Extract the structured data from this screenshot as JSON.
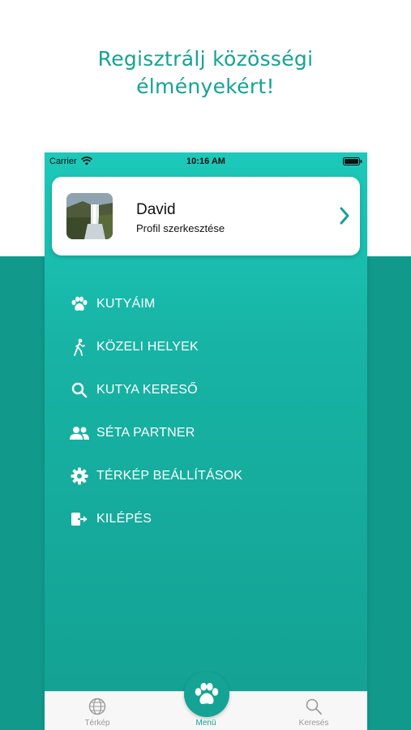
{
  "headline": {
    "line1": "Regisztrálj közösségi",
    "line2": "élményekért!"
  },
  "status_bar": {
    "carrier": "Carrier",
    "time": "10:16 AM"
  },
  "profile": {
    "name": "David",
    "subtitle": "Profil szerkesztése"
  },
  "menu": {
    "items": [
      {
        "label": "KUTYÁIM",
        "icon": "paw-icon"
      },
      {
        "label": "KÖZELI HELYEK",
        "icon": "walking-person-icon"
      },
      {
        "label": "KUTYA KERESŐ",
        "icon": "search-icon"
      },
      {
        "label": "SÉTA PARTNER",
        "icon": "users-icon"
      },
      {
        "label": "TÉRKÉP BEÁLLÍTÁSOK",
        "icon": "gear-icon"
      },
      {
        "label": "KILÉPÉS",
        "icon": "logout-icon"
      }
    ]
  },
  "tab_bar": {
    "tabs": [
      {
        "label": "Térkép",
        "icon": "globe-icon"
      },
      {
        "label": "Menü",
        "icon": "paw-icon",
        "active": true
      },
      {
        "label": "Keresés",
        "icon": "search-icon"
      }
    ]
  },
  "colors": {
    "accent": "#14a394",
    "band": "#119a8c",
    "gradient_top": "#1cc9ba"
  }
}
